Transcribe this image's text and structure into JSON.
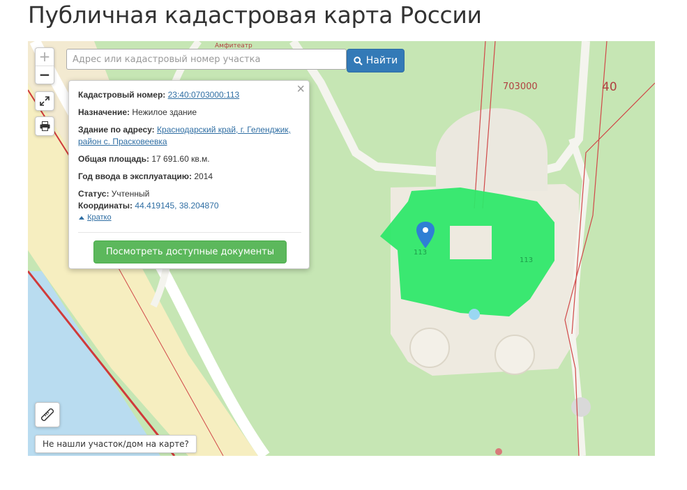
{
  "page": {
    "title": "Публичная кадастровая карта России"
  },
  "search": {
    "placeholder": "Адрес или кадастровый номер участка",
    "button_label": "Найти"
  },
  "map": {
    "zoom_in": "+",
    "zoom_out": "−",
    "labels": {
      "block": "703000",
      "parcel_40": "40",
      "parcel_113_a": "113",
      "parcel_113_b": "113",
      "place": "Амфитеатр"
    },
    "colors": {
      "water": "#b9dcf0",
      "park": "#c6e6b4",
      "selection": "#2fe86a",
      "road": "#ffffff",
      "boundary": "#d04848"
    }
  },
  "popup": {
    "close": "×",
    "cadastral_label": "Кадастровый номер:",
    "cadastral_value": "23:40:0703000:113",
    "purpose_label": "Назначение:",
    "purpose_value": "Нежилое здание",
    "address_label": "Здание по адресу:",
    "address_value_line1": "Краснодарский край, г. Геленджик,",
    "address_value_line2": "район с. Прасковеевка",
    "area_label": "Общая площадь:",
    "area_value": "17 691.60 кв.м.",
    "year_label": "Год ввода в эксплуатацию:",
    "year_value": "2014",
    "status_label": "Статус:",
    "status_value": "Учтенный",
    "coords_label": "Координаты:",
    "lat": "44.419145",
    "coord_sep": ",",
    "lon": "38.204870",
    "toggle_label": "Кратко",
    "docs_button": "Посмотреть доступные документы"
  },
  "footer": {
    "not_found_label": "Не нашли участок/дом на карте?"
  }
}
